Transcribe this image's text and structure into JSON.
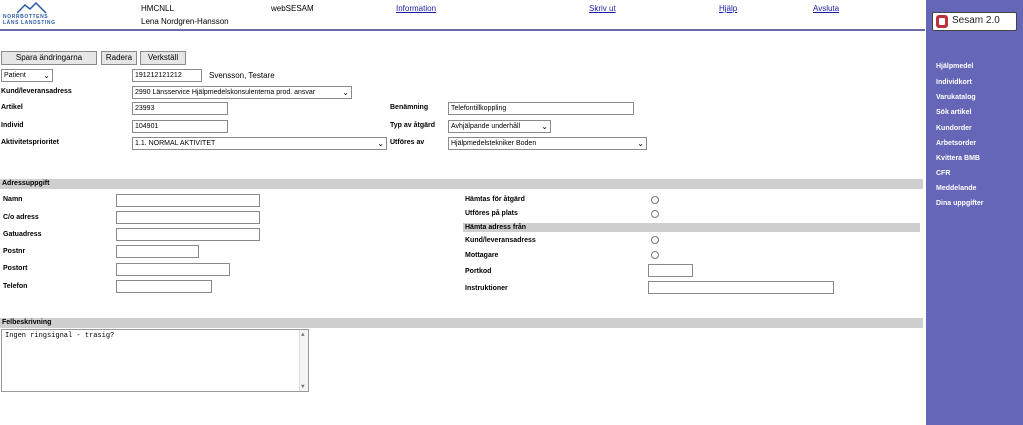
{
  "header": {
    "logo_line1": "NORRBOTTENS",
    "logo_line2": "LÄNS LANDSTING",
    "org_code": "HMCNLL",
    "user_name": "Lena Nordgren-Hansson",
    "app_name": "webSESAM",
    "links": {
      "information": "Information",
      "print": "Skriv ut",
      "help": "Hjälp",
      "logout": "Avsluta"
    }
  },
  "sidebar": {
    "brand": "Sesam 2.0",
    "items": [
      "Hjälpmedel",
      "Individkort",
      "Varukatalog",
      "Sök artikel",
      "Kundorder",
      "Arbetsorder",
      "Kvittera BMB",
      "CFR",
      "Meddelande",
      "Dina uppgifter"
    ]
  },
  "toolbar": {
    "save_label": "Spara ändringarna",
    "delete_label": "Radera",
    "apply_label": "Verkställ"
  },
  "form": {
    "type_select": "Patient",
    "person_id": "191212121212",
    "person_name": "Svensson, Testare",
    "customer_label": "Kund/leveransadress",
    "customer_value": "2990 Länsservice Hjälpmedelskonsulenterna prod. ansvar",
    "article_label": "Artikel",
    "article_value": "23993",
    "name_label": "Benämning",
    "name_value": "Telefontillkoppling",
    "individ_label": "Individ",
    "individ_value": "104901",
    "action_type_label": "Typ av åtgärd",
    "action_type_value": "Avhjälpande underhåll",
    "priority_label": "Aktivitetsprioritet",
    "priority_value": "1.1. NORMAL AKTIVITET",
    "performed_by_label": "Utföres av",
    "performed_by_value": "Hjälpmedelstekniker Boden"
  },
  "address": {
    "section_title": "Adressuppgift",
    "fields": {
      "name": "Namn",
      "co": "C/o adress",
      "street": "Gatuadress",
      "zip": "Postnr",
      "city": "Postort",
      "phone": "Telefon"
    },
    "right": {
      "fetch_for_action": "Hämtas för åtgärd",
      "performed_on_site": "Utföres på plats",
      "fetch_from_title": "Hämta adress från",
      "customer_address": "Kund/leveransadress",
      "receiver": "Mottagare",
      "door_code": "Portkod",
      "instructions": "Instruktioner"
    }
  },
  "fault": {
    "section_title": "Felbeskrivning",
    "text": "Ingen ringsignal - trasig?"
  }
}
